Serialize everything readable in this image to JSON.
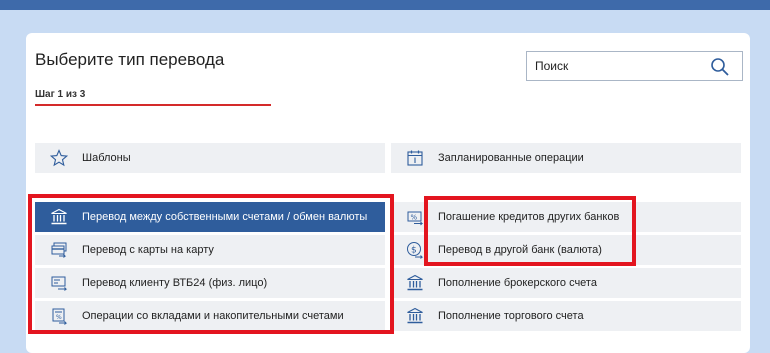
{
  "page": {
    "title": "Выберите тип перевода",
    "step": "Шаг 1 из 3",
    "search_placeholder": "Поиск"
  },
  "colors": {
    "accent_red": "#d42a2a",
    "active_row": "#2f5d9c",
    "highlight": "#e3151f",
    "page_bg": "#c8dbf3",
    "topbar": "#3e6aaa"
  },
  "top_items": [
    {
      "label": "Шаблоны",
      "icon": "star-icon"
    },
    {
      "label": "Запланированные операции",
      "icon": "calendar-icon"
    }
  ],
  "left_items": [
    {
      "label": "Перевод между собственными счетами / обмен валюты",
      "icon": "bank-icon",
      "active": true
    },
    {
      "label": "Перевод с карты на карту",
      "icon": "card-icon"
    },
    {
      "label": "Перевод клиенту ВТБ24 (физ. лицо)",
      "icon": "transfer-icon"
    },
    {
      "label": "Операции со вкладами и накопительными счетами",
      "icon": "deposit-icon"
    }
  ],
  "right_items": [
    {
      "label": "Погашение кредитов других банков",
      "icon": "percent-icon"
    },
    {
      "label": "Перевод в другой банк (валюта)",
      "icon": "dollar-icon"
    },
    {
      "label": "Пополнение брокерского счета",
      "icon": "bank-icon"
    },
    {
      "label": "Пополнение торгового счета",
      "icon": "bank-icon"
    }
  ]
}
